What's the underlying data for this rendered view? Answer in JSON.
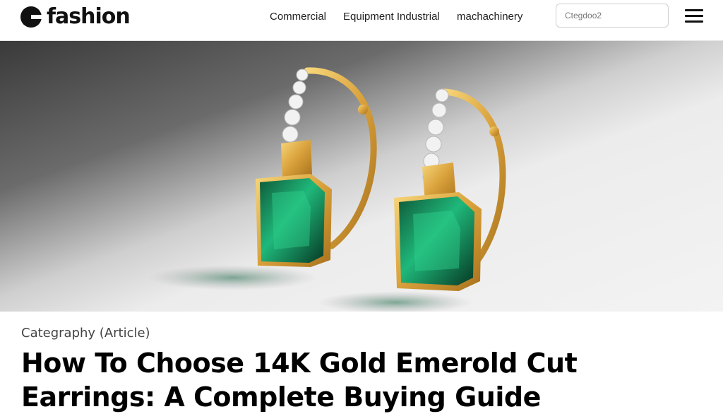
{
  "header": {
    "logo_text": "fashion",
    "nav": [
      "Commercial",
      "Equipment Industrial",
      "machachinery"
    ],
    "search_placeholder": "Ctegdoo2",
    "menu_icon": "hamburger-icon"
  },
  "hero": {
    "image_subject": "emerald-cut earrings"
  },
  "article": {
    "category": "Categraphy (Article)",
    "title": "How To Choose 14K Gold Emerold Cut Earrings: A Complete Buying Guide"
  }
}
